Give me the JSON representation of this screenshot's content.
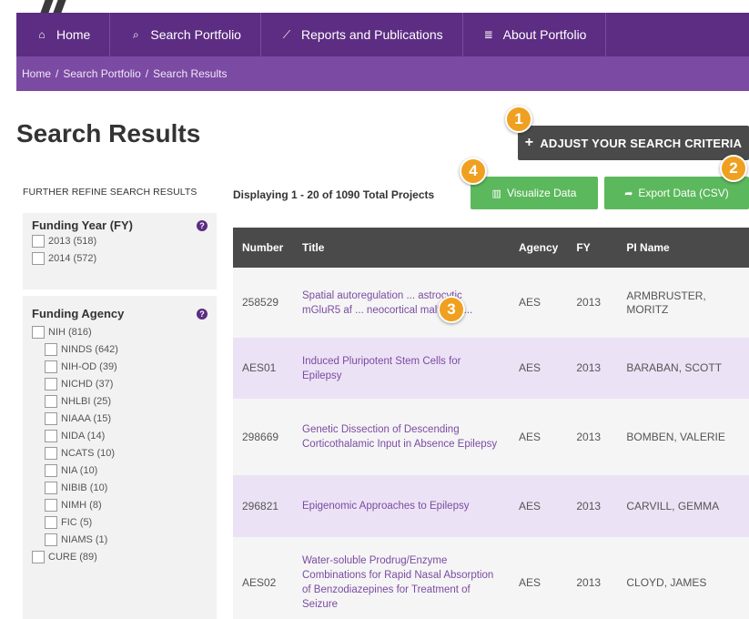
{
  "nav": {
    "items": [
      {
        "icon": "home-icon",
        "glyph": "⌂",
        "label": "Home"
      },
      {
        "icon": "search-icon",
        "glyph": "⌕",
        "label": "Search Portfolio"
      },
      {
        "icon": "line-chart-icon",
        "glyph": "⟋",
        "label": "Reports and Publications"
      },
      {
        "icon": "database-icon",
        "glyph": "≣",
        "label": "About Portfolio"
      }
    ]
  },
  "breadcrumb": {
    "items": [
      "Home",
      "/",
      "Search Portfolio",
      "/",
      "Search Results"
    ]
  },
  "page": {
    "title": "Search Results",
    "adjust_button": "ADJUST YOUR SEARCH CRITERIA",
    "adjust_plus": "+",
    "display_count": "Displaying 1 - 20 of 1090 Total Projects",
    "visualize_button": "Visualize Data",
    "export_button": "Export Data (CSV)"
  },
  "badges": [
    "1",
    "2",
    "3",
    "4"
  ],
  "refine": {
    "heading": "FURTHER REFINE SEARCH RESULTS",
    "funding_year": {
      "title": "Funding Year (FY)",
      "help": "?",
      "options": [
        "2013 (518)",
        "2014 (572)"
      ]
    },
    "funding_agency": {
      "title": "Funding Agency",
      "help": "?",
      "nih": "NIH (816)",
      "nih_children": [
        "NINDS (642)",
        "NIH-OD (39)",
        "NICHD (37)",
        "NHLBI (25)",
        "NIAAA (15)",
        "NIDA (14)",
        "NCATS (10)",
        "NIA (10)",
        "NIBIB (10)",
        "NIMH (8)",
        "FIC (5)",
        "NIAMS (1)"
      ],
      "cure": "CURE (89)"
    }
  },
  "table": {
    "headers": [
      "Number",
      "Title",
      "Agency",
      "FY",
      "PI Name"
    ],
    "rows": [
      {
        "number": "258529",
        "title": "Spatial autoregulation ... astrocytic mGluR5 af ... neocortical malforma...",
        "agency": "AES",
        "fy": "2013",
        "pi": "ARMBRUSTER, MORITZ"
      },
      {
        "number": "AES01",
        "title": "Induced Pluripotent Stem Cells for Epilepsy",
        "agency": "AES",
        "fy": "2013",
        "pi": "BARABAN, SCOTT"
      },
      {
        "number": "298669",
        "title": "Genetic Dissection of Descending Corticothalamic Input in Absence Epilepsy",
        "agency": "AES",
        "fy": "2013",
        "pi": "BOMBEN, VALERIE"
      },
      {
        "number": "296821",
        "title": "Epigenomic Approaches to Epilepsy",
        "agency": "AES",
        "fy": "2013",
        "pi": "CARVILL, GEMMA"
      },
      {
        "number": "AES02",
        "title": "Water-soluble Prodrug/Enzyme Combinations for Rapid Nasal Absorption of Benzodiazepines for Treatment of Seizure",
        "agency": "AES",
        "fy": "2013",
        "pi": "CLOYD, JAMES"
      }
    ]
  },
  "colors": {
    "nav": "#5c2d82",
    "breadcrumb": "#7b4ba3",
    "button_dark": "#4a4a4a",
    "button_green": "#5cb85c",
    "badge": "#f0a020",
    "row_highlight": "#ece2f5"
  }
}
